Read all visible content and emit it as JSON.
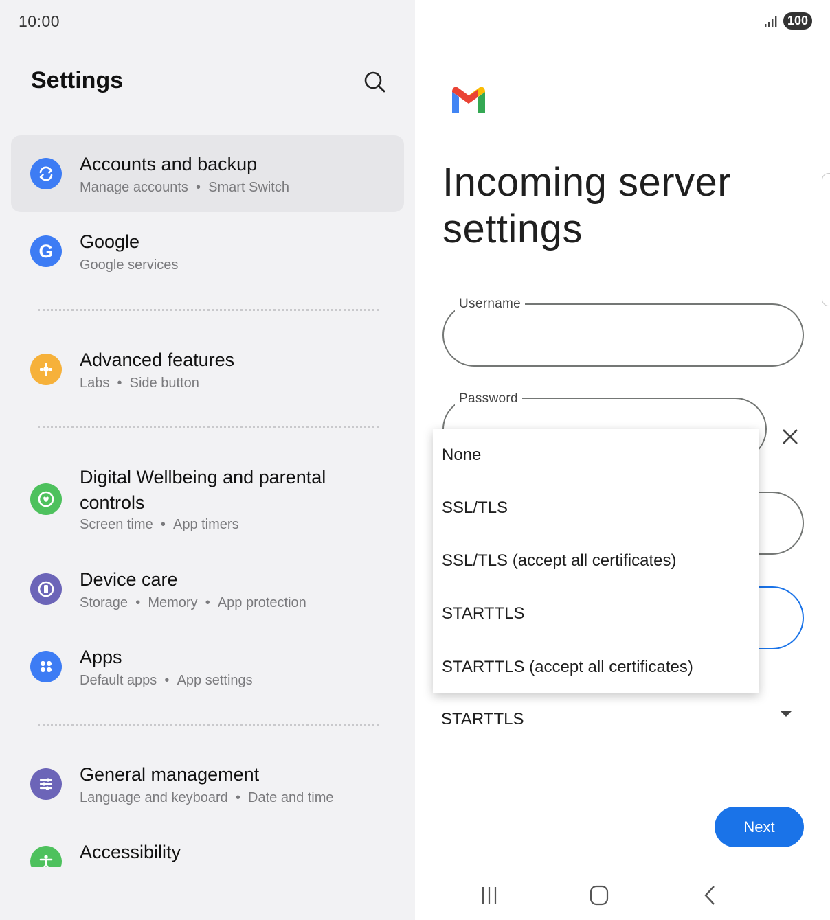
{
  "status_bar": {
    "time": "10:00",
    "battery": "100"
  },
  "left": {
    "title": "Settings",
    "items": [
      {
        "title": "Accounts and backup",
        "subtitle": [
          "Manage accounts",
          "Smart Switch"
        ]
      },
      {
        "title": "Google",
        "subtitle": [
          "Google services"
        ]
      },
      {
        "title": "Advanced features",
        "subtitle": [
          "Labs",
          "Side button"
        ]
      },
      {
        "title_lines": [
          "Digital Wellbeing and parental",
          "controls"
        ],
        "subtitle": [
          "Screen time",
          "App timers"
        ]
      },
      {
        "title": "Device care",
        "subtitle": [
          "Storage",
          "Memory",
          "App protection"
        ]
      },
      {
        "title": "Apps",
        "subtitle": [
          "Default apps",
          "App settings"
        ]
      },
      {
        "title": "General management",
        "subtitle": [
          "Language and keyboard",
          "Date and time"
        ]
      },
      {
        "title": "Accessibility"
      }
    ],
    "separator": "•",
    "icon_colors": {
      "accounts": "#3d7cf4",
      "google": "#3d7cf4",
      "advanced": "#f6b13a",
      "wellbeing": "#4ec15d",
      "device_care": "#6c65b8",
      "apps": "#3d7cf4",
      "general": "#6c65b8",
      "accessibility": "#4ec15d"
    }
  },
  "right": {
    "heading_lines": [
      "Incoming server",
      "settings"
    ],
    "username_label": "Username",
    "password_label": "Password",
    "security_value": "STARTTLS",
    "next_label": "Next",
    "accent": "#1a73e8"
  },
  "dropdown": {
    "options": [
      "None",
      "SSL/TLS",
      "SSL/TLS (accept all certificates)",
      "STARTTLS",
      "STARTTLS (accept all certificates)"
    ]
  }
}
